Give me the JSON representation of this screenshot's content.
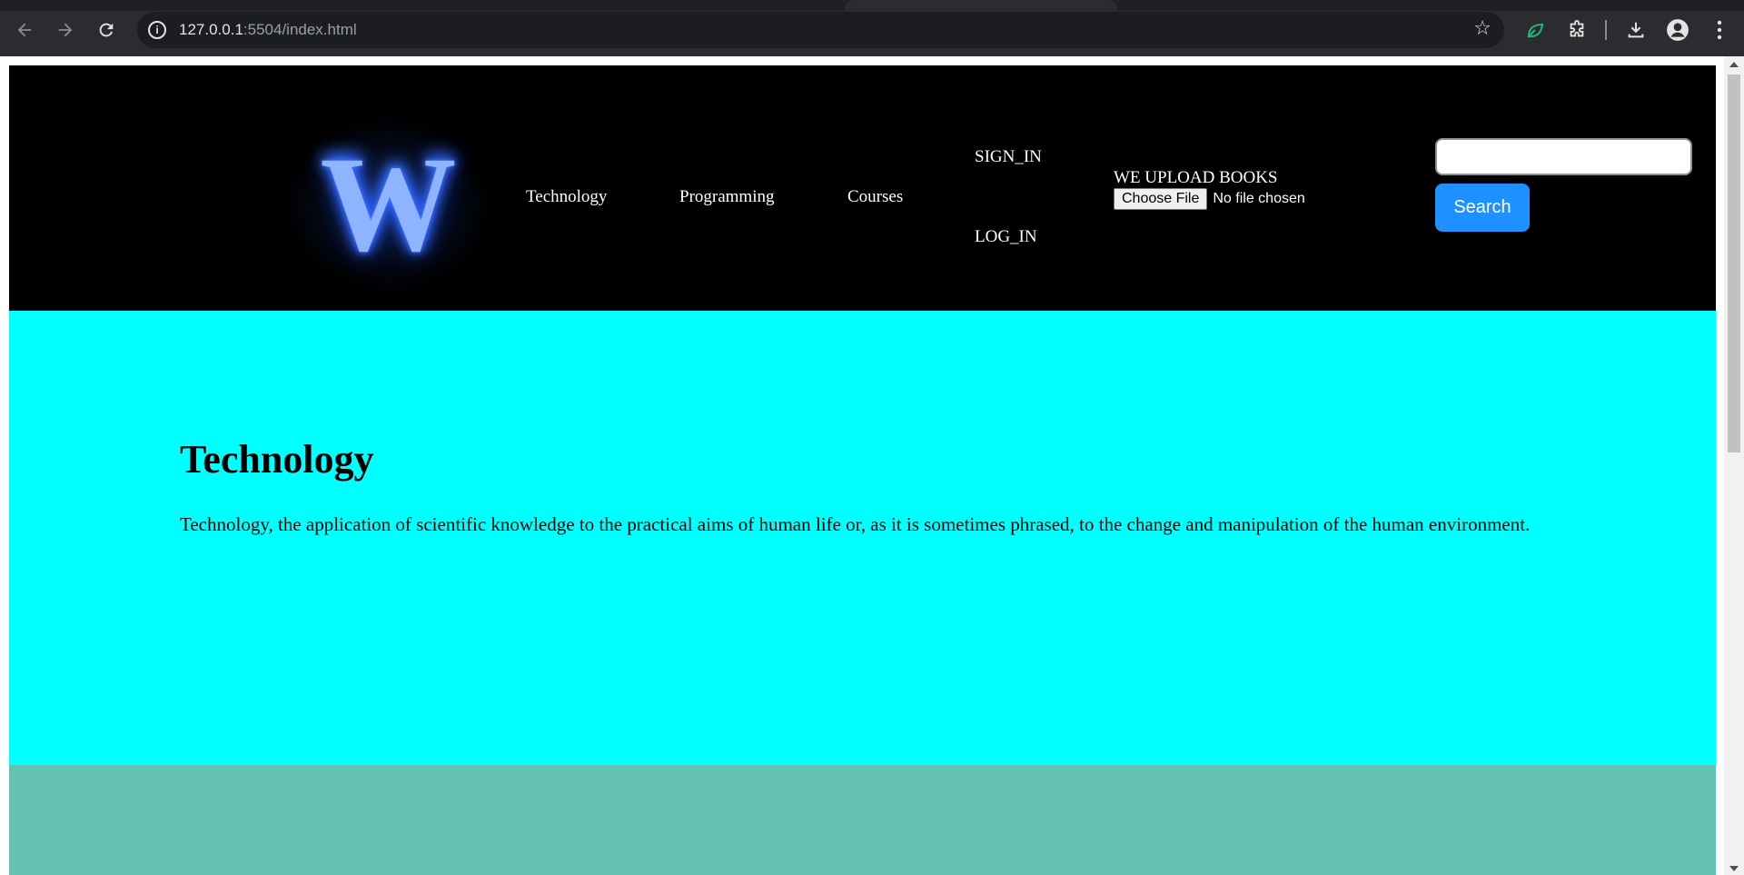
{
  "browser": {
    "url_host": "127.0.0.1",
    "url_rest": ":5504/index.html",
    "icons": {
      "back": "back-arrow-icon",
      "forward": "forward-arrow-icon",
      "reload": "reload-icon",
      "site_info": "site-info-icon",
      "bookmark": "star-icon",
      "extension_leaf": "leaf-icon",
      "extensions": "puzzle-icon",
      "downloads": "download-icon",
      "profile": "avatar-icon",
      "menu": "kebab-menu-icon"
    }
  },
  "header": {
    "logo_letter": "W",
    "nav": {
      "technology": "Technology",
      "programming": "Programming",
      "courses": "Courses",
      "sign_in": "SIGN_IN",
      "log_in": "LOG_IN"
    },
    "upload": {
      "label": "WE UPLOAD BOOKS",
      "button": "Choose File",
      "status": "No file chosen"
    },
    "search": {
      "value": "",
      "button": "Search"
    }
  },
  "content": {
    "title": "Technology",
    "description": "Technology, the application of scientific knowledge to the practical aims of human life or, as it is sometimes phrased, to the change and manipulation of the human environment."
  },
  "colors": {
    "header_bg": "#000000",
    "section_bg": "#00ffff",
    "next_section_bg": "#66c2b0",
    "search_button": "#1e90ff"
  }
}
